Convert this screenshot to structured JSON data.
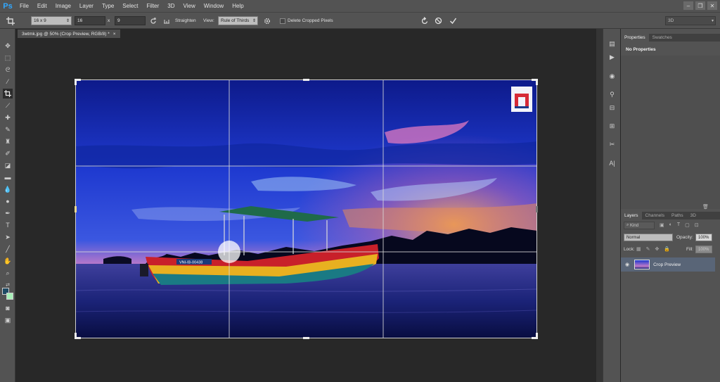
{
  "menu": {
    "app_icon": "Ps",
    "items": [
      "File",
      "Edit",
      "Image",
      "Layer",
      "Type",
      "Select",
      "Filter",
      "3D",
      "View",
      "Window",
      "Help"
    ],
    "window_controls": [
      "–",
      "❐",
      "✕"
    ]
  },
  "options": {
    "ratio_select": "16 x 9",
    "width_value": "16",
    "x_label": "x",
    "height_value": "9",
    "straighten_label": "Straighten",
    "view_label": "View:",
    "view_select": "Rule of Thirds",
    "delete_cropped_label": "Delete Cropped Pixels",
    "workspace_select": "3D"
  },
  "document": {
    "tab_title": "3wtmk.jpg @ 50% (Crop Preview, RGB/8) *",
    "close_symbol": "×",
    "boat_registration": "VNI-IB-00438"
  },
  "properties_panel": {
    "tabs": [
      "Properties",
      "Swatches"
    ],
    "title": "No Properties"
  },
  "layers_panel": {
    "tabs": [
      "Layers",
      "Channels",
      "Paths",
      "3D"
    ],
    "kind_label": "Kind",
    "blend_mode": "Normal",
    "opacity_label": "Opacity:",
    "opacity_value": "100%",
    "lock_label": "Lock:",
    "fill_label": "Fill:",
    "fill_value": "100%",
    "layer_name": "Crop Preview"
  },
  "colors": {
    "foreground": "#1e4a63",
    "background": "#a8f0b8",
    "accent": "#31a8ff"
  }
}
